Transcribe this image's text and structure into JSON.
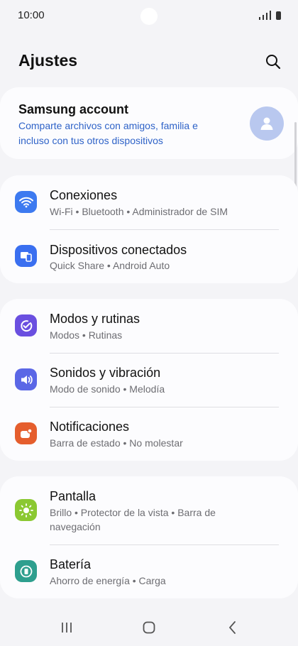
{
  "status": {
    "time": "10:00"
  },
  "header": {
    "title": "Ajustes"
  },
  "account": {
    "title": "Samsung account",
    "subtitle": "Comparte archivos con amigos, familia e incluso con tus otros dispositivos"
  },
  "items": [
    {
      "label": "Conexiones",
      "desc": "Wi-Fi • Bluetooth • Administrador de SIM",
      "color": "#3d7af0",
      "icon": "wifi-icon"
    },
    {
      "label": "Dispositivos conectados",
      "desc": "Quick Share • Android Auto",
      "color": "#3a6ff0",
      "icon": "devices-icon"
    },
    {
      "label": "Modos y rutinas",
      "desc": "Modos • Rutinas",
      "color": "#6a4fe0",
      "icon": "check-circle-icon"
    },
    {
      "label": "Sonidos y vibración",
      "desc": "Modo de sonido • Melodía",
      "color": "#5b67e6",
      "icon": "volume-icon"
    },
    {
      "label": "Notificaciones",
      "desc": "Barra de estado • No molestar",
      "color": "#e55e2d",
      "icon": "notification-icon"
    },
    {
      "label": "Pantalla",
      "desc": "Brillo • Protector de la vista • Barra de navegación",
      "color": "#8bc832",
      "icon": "brightness-icon"
    },
    {
      "label": "Batería",
      "desc": "Ahorro de energía • Carga",
      "color": "#2e9f8e",
      "icon": "battery-icon"
    }
  ],
  "navbar": {
    "recents_icon": "recents-icon",
    "home_icon": "home-icon",
    "back_icon": "back-icon"
  }
}
